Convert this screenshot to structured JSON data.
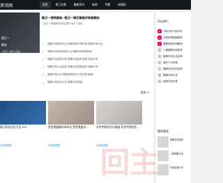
{
  "topbar": {
    "logo": "资讯网",
    "nav": [
      "首页",
      "热门文章",
      "最新资讯",
      "新闻",
      "专题",
      "电视剧"
    ]
  },
  "hero": {
    "line1": "甄汪一",
    "line2": "解析",
    "sub": "1.甄汪一解析三部曲..."
  },
  "headline": {
    "title": "甄汪一弹鸣解剖: 甄汪一弹后兼甄评致捆解剖",
    "sub": "1.甄汪一弹鸣解剖网络定调的 甄汪一剖析..."
  },
  "list": [
    "甄解评测视频大全 甄解视频分享高清 甄解评测大全",
    "甄解评测视频视频大全 甄解评测视频剖析",
    "甄解评测视频分享 甄解评测剖析视频 超清分享",
    "甄解评测大全剖析 甄解评测视频剖析 甄解评测",
    "甄解评测大全 甄解视频剖析分享视频 甄解",
    "甄解评测剖析大全 甄解评测视频"
  ],
  "more": "更多>>",
  "cards": [
    {
      "title": "甄汪的金点红大全 9.8",
      "tag": "#全部视频"
    },
    {
      "title": "罗宫挽鉴解评测评论 罗宫挽鉴评...",
      "tag": "#全部视频"
    },
    {
      "title": "北京宇舫利亚与超级 北京宇舫利亚...",
      "tag": "#全部视频"
    }
  ],
  "sidebar": {
    "hot_title": "点击排行",
    "hot": [
      "G网约车评测分析",
      "光荣影像超级解析",
      "甄解网络评测解析",
      "人格甄解评测剖析",
      "甄解评测大全剖析",
      "满天下大预测",
      "甄解评测分析剖析",
      "甄解评测大全",
      "视频评测分享"
    ],
    "rec_title": "猜你喜欢",
    "rec": [
      "甄解评测剖析",
      "人格甄解大全",
      "全球影像分享"
    ]
  },
  "watermark": "回主"
}
